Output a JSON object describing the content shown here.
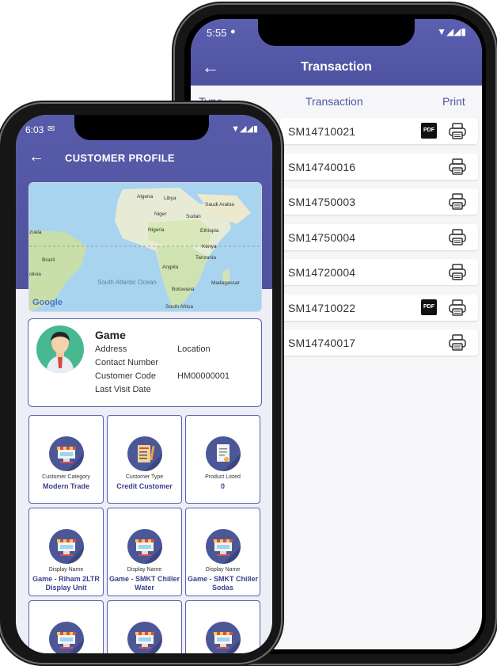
{
  "transaction_screen": {
    "status_time": "5:55",
    "title": "Transaction",
    "back_glyph": "←",
    "columns": [
      "Type",
      "Transaction",
      "Print"
    ],
    "rows": [
      {
        "id": "SM14710021",
        "has_pdf": true
      },
      {
        "id": "SM14740016",
        "has_pdf": false
      },
      {
        "id": "SM14750003",
        "has_pdf": false
      },
      {
        "id": "SM14750004",
        "has_pdf": false
      },
      {
        "id": "SM14720004",
        "has_pdf": false
      },
      {
        "id": "SM14710022",
        "has_pdf": true
      },
      {
        "id": "SM14740017",
        "has_pdf": false
      }
    ],
    "pdf_label": "PDF",
    "icons": {
      "print": "printer-icon",
      "pdf": "pdf-icon",
      "back": "arrow-left-icon"
    }
  },
  "customer_screen": {
    "status_time": "6:03",
    "title": "CUSTOMER PROFILE",
    "back_glyph": "←",
    "map_labels": {
      "algeria": "Algeria",
      "libya": "Libya",
      "saudi": "Saudi Arabia",
      "niger": "Niger",
      "sudan": "Sudan",
      "nigeria": "Nigeria",
      "ethiopia": "Ethiopia",
      "zuela": "zuela",
      "kenya": "Kenya",
      "tanzania": "Tanzania",
      "brazil": "Brazil",
      "angola": "Angola",
      "olivia": "olivia",
      "madagascar": "Madagascar",
      "south_atlantic": "South Atlantic Ocean",
      "botswana": "Botswana",
      "south_africa": "South Africa",
      "google": "Google"
    },
    "profile": {
      "name": "Game",
      "address_label": "Address",
      "location_label": "Location",
      "contact_label": "Contact Number",
      "code_label": "Customer Code",
      "code_value": "HM00000001",
      "last_visit_label": "Last Visit Date"
    },
    "tiles": [
      {
        "caption": "Customer Category",
        "value": "Modern Trade",
        "icon": "store-icon"
      },
      {
        "caption": "Customer Type",
        "value": "Credit Customer",
        "icon": "clipboard-icon"
      },
      {
        "caption": "Product Listed",
        "value": "0",
        "icon": "document-icon"
      },
      {
        "caption": "Display Name",
        "value": "Game - Riham 2LTR Display Unit",
        "icon": "store-icon"
      },
      {
        "caption": "Display Name",
        "value": "Game - SMKT Chiller Water",
        "icon": "store-icon"
      },
      {
        "caption": "Display Name",
        "value": "Game - SMKT Chiller Sodas",
        "icon": "store-icon"
      }
    ],
    "colors": {
      "header": "#5357a6",
      "accent": "#3c3f8a",
      "border": "#5b5fae"
    }
  }
}
